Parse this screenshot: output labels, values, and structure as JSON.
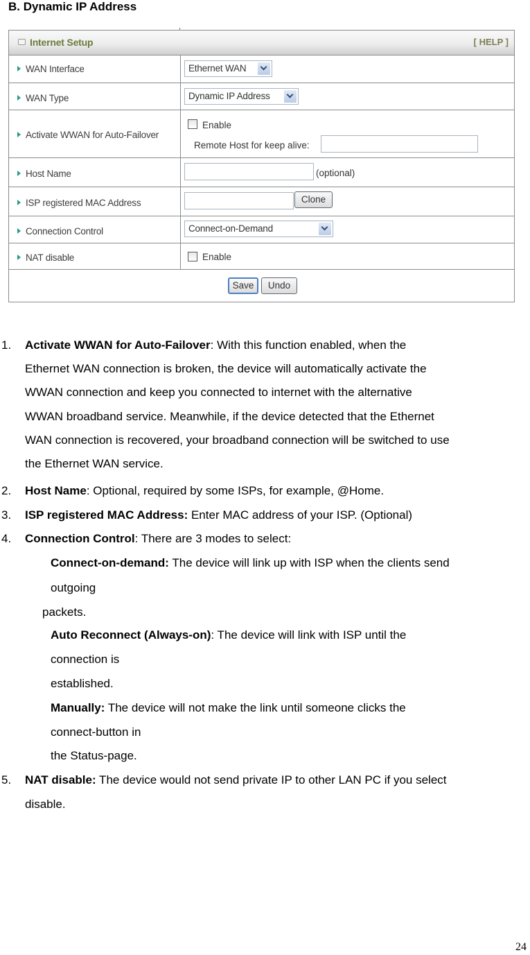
{
  "section_title": "B. Dynamic IP Address",
  "panel": {
    "title": "Internet Setup",
    "help_link": "[ HELP ]",
    "rows": [
      {
        "label": "WAN Interface",
        "select_value": "Ethernet WAN"
      },
      {
        "label": "WAN Type",
        "select_value": "Dynamic IP Address"
      },
      {
        "label": "Activate WWAN for Auto-Failover",
        "checkbox_label": "Enable",
        "checked": false,
        "remote_host_label": "Remote Host for keep alive:",
        "remote_host_value": ""
      },
      {
        "label": "Host Name",
        "value": "",
        "hint": "(optional)"
      },
      {
        "label": "ISP registered MAC Address",
        "value": "",
        "button": "Clone"
      },
      {
        "label": "Connection Control",
        "select_value": "Connect-on-Demand"
      },
      {
        "label": "NAT disable",
        "checkbox_label": "Enable",
        "checked": false
      }
    ],
    "save_button": "Save",
    "undo_button": "Undo"
  },
  "items": [
    {
      "num": "1.",
      "term": "Activate WWAN for Auto-Failover",
      "sep": ":",
      "lines": [
        " With this function enabled, when the",
        "Ethernet WAN connection is broken, the device will automatically activate the",
        "WWAN connection and keep you connected to internet with the alternative",
        "WWAN broadband service. Meanwhile, if the device detected that the Ethernet",
        "WAN connection is recovered, your broadband connection will be switched to use",
        "the Ethernet WAN service."
      ]
    },
    {
      "num": "2.",
      "term": "Host Name",
      "sep": ":",
      "text": " Optional, required by some ISPs, for example, @Home."
    },
    {
      "num": "3.",
      "term": "ISP registered MAC Address:",
      "sep": "",
      "text": " Enter MAC address of your ISP. (Optional)"
    },
    {
      "num": "4.",
      "term": "Connection Control",
      "sep": ":",
      "text": " There are 3 modes to select:"
    },
    {
      "num": "5.",
      "term": "NAT disable:",
      "sep": "",
      "lines": [
        " The device would not send private IP to other LAN PC if you select",
        "disable."
      ]
    }
  ],
  "modes": [
    {
      "term": "Connect-on-demand:",
      "lines": [
        " The device will link up with ISP when the clients send",
        "outgoing",
        "packets."
      ]
    },
    {
      "term": "Auto Reconnect (Always-on)",
      "sep": ":",
      "lines": [
        " The device will link with ISP until the",
        "connection is",
        "established."
      ]
    },
    {
      "term": "Manually:",
      "lines": [
        " The device will not make the link until someone clicks the",
        "connect-button in",
        "the Status-page."
      ]
    }
  ],
  "page_number": "24",
  "colors": {
    "arrow": "#2b9a88",
    "header_title": "#6b7a3a",
    "button_focus": "#4a7fc0"
  }
}
